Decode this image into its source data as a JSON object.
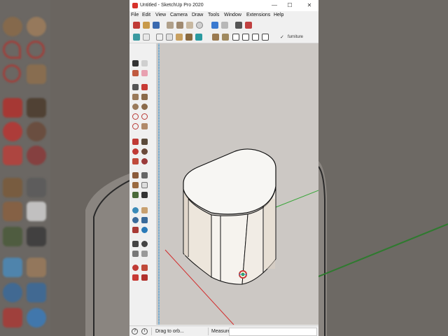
{
  "window": {
    "title": "Untitled - SketchUp Pro 2020",
    "minimize_glyph": "—",
    "maximize_glyph": "☐",
    "close_glyph": "✕"
  },
  "menu": [
    "File",
    "Edit",
    "View",
    "Camera",
    "Draw",
    "Tools",
    "Window",
    "Extensions",
    "Help"
  ],
  "toolbar2": {
    "tag_check": "✓",
    "tag_name": "furniture"
  },
  "status": {
    "help_glyph": "?",
    "info_glyph": "i",
    "message": "Drag to orb...",
    "measurements_label": "Measurements",
    "measurements_value": ""
  },
  "colors": {
    "viewport_bg": "#ccc8c4",
    "model_face": "#f4f2ee",
    "axis_red": "#d22c2c",
    "axis_green": "#3aa63a",
    "axis_blue": "#2a8fd8"
  }
}
